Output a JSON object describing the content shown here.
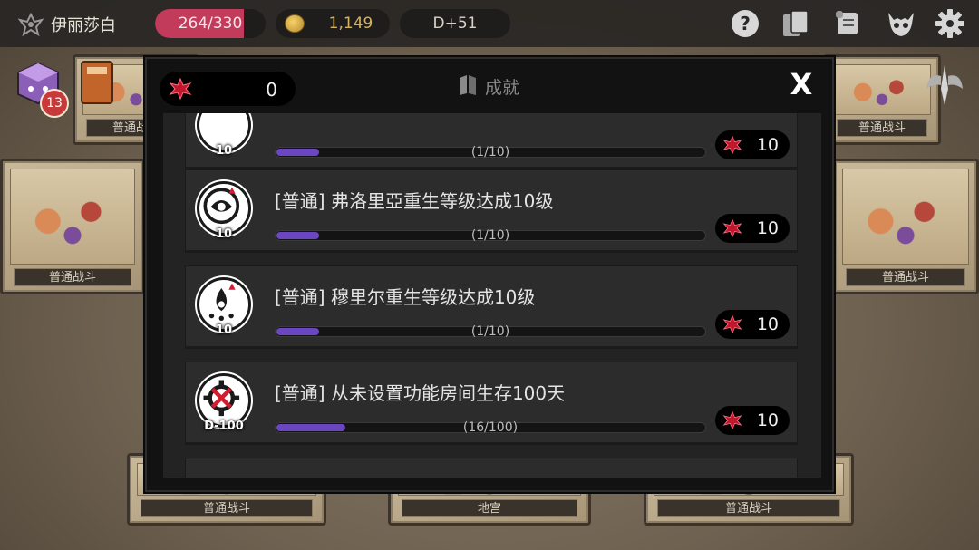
{
  "topbar": {
    "player_name": "伊丽莎白",
    "hp_text": "264/330",
    "hp_fraction": 0.8,
    "gold": "1,149",
    "day": "D+51"
  },
  "side": {
    "badge_count": "13"
  },
  "board_cards": [
    {
      "label": "普通战斗"
    },
    {
      "label": "普通战斗"
    },
    {
      "label": "普通战斗"
    },
    {
      "label": "普通战斗"
    },
    {
      "label": "地宫"
    },
    {
      "label": "普通战斗"
    },
    {
      "label": "普通战斗"
    }
  ],
  "modal": {
    "gem_count": "0",
    "title": "成就",
    "close_label": "X",
    "achievements": [
      {
        "title": "",
        "icon_label": "10",
        "progress_text": "(1/10)",
        "progress": 0.1,
        "reward": "10",
        "icon": "rebirth-icon"
      },
      {
        "title": "[普通] 弗洛里亞重生等级达成10级",
        "icon_label": "10",
        "progress_text": "(1/10)",
        "progress": 0.1,
        "reward": "10",
        "icon": "swirl-eye-icon"
      },
      {
        "title": "[普通] 穆里尔重生等级达成10级",
        "icon_label": "10",
        "progress_text": "(1/10)",
        "progress": 0.1,
        "reward": "10",
        "icon": "drop-icon"
      },
      {
        "title": "[普通] 从未设置功能房间生存100天",
        "icon_label": "D-100",
        "progress_text": "(16/100)",
        "progress": 0.16,
        "reward": "10",
        "icon": "crossed-gear-icon"
      }
    ]
  },
  "colors": {
    "hp": "#c23b5b",
    "progress": "#6b46c1",
    "gold": "#d5b35f",
    "gem": "#c0162e"
  }
}
